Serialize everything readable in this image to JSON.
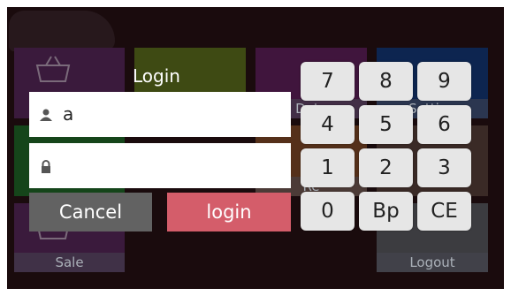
{
  "tiles": {
    "sale_label": "Sale",
    "data_label": "Data",
    "setting_label": "Setting",
    "re_label": "Re",
    "logout_label": "Logout"
  },
  "login": {
    "title": "Login",
    "username_value": "a",
    "password_value": "",
    "cancel_label": "Cancel",
    "login_label": "login"
  },
  "keypad": {
    "k7": "7",
    "k8": "8",
    "k9": "9",
    "k4": "4",
    "k5": "5",
    "k6": "6",
    "k1": "1",
    "k2": "2",
    "k3": "3",
    "k0": "0",
    "kbp": "Bp",
    "kce": "CE"
  },
  "colors": {
    "login_button": "#d45d6a",
    "cancel_button": "#626262",
    "key_background": "#e6e6e6"
  },
  "icons": [
    "user-icon",
    "lock-icon",
    "basket-icon"
  ]
}
